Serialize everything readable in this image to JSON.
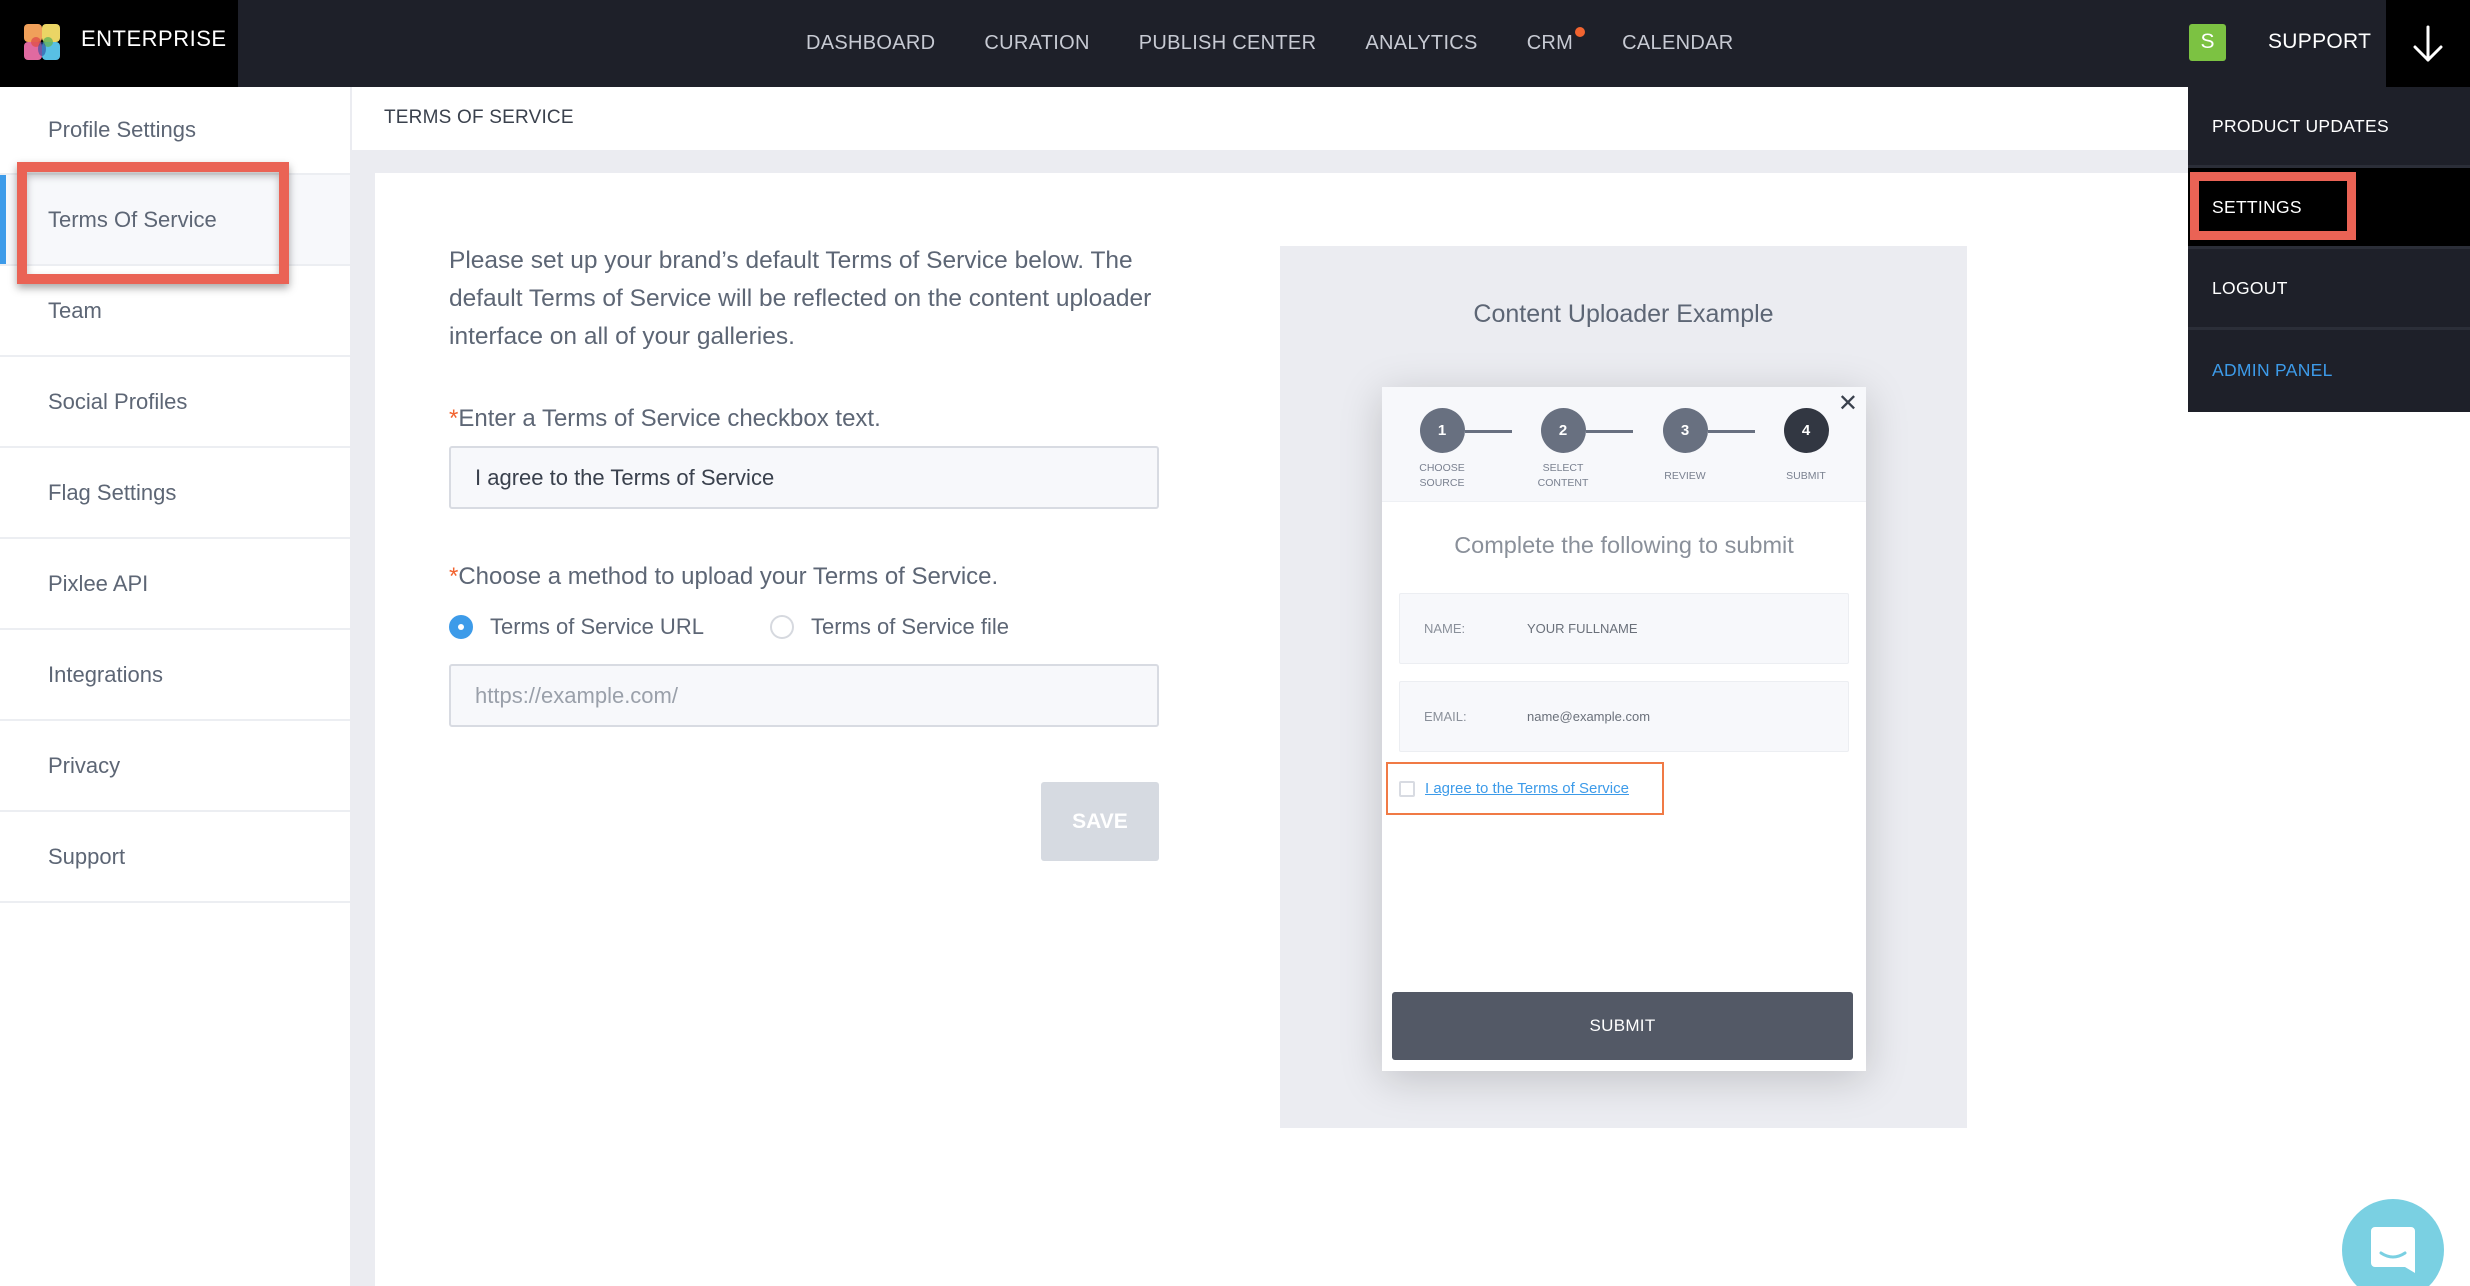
{
  "header": {
    "brand": "ENTERPRISE",
    "nav": [
      {
        "label": "DASHBOARD",
        "badge": false
      },
      {
        "label": "CURATION",
        "badge": false
      },
      {
        "label": "PUBLISH CENTER",
        "badge": false
      },
      {
        "label": "ANALYTICS",
        "badge": false
      },
      {
        "label": "CRM",
        "badge": true
      },
      {
        "label": "CALENDAR",
        "badge": false
      }
    ],
    "avatar_initial": "S",
    "support_label": "SUPPORT",
    "menu_icon": "arrow-down-icon"
  },
  "dropdown": {
    "items": [
      {
        "label": "PRODUCT UPDATES"
      },
      {
        "label": "SETTINGS",
        "selected": true
      },
      {
        "label": "LOGOUT"
      },
      {
        "label": "ADMIN PANEL"
      }
    ]
  },
  "sidebar": {
    "items": [
      {
        "label": "Profile Settings"
      },
      {
        "label": "Terms Of Service",
        "active": true
      },
      {
        "label": "Team"
      },
      {
        "label": "Social Profiles"
      },
      {
        "label": "Flag Settings"
      },
      {
        "label": "Pixlee API"
      },
      {
        "label": "Integrations"
      },
      {
        "label": "Privacy"
      },
      {
        "label": "Support"
      }
    ]
  },
  "page": {
    "title": "TERMS OF SERVICE",
    "intro": "Please set up your brand’s default Terms of Service below. The default Terms of Service will be reflected on the content uploader interface on all of your galleries.",
    "checkbox_text_label": "Enter a Terms of Service checkbox text.",
    "checkbox_text_value": "I agree to the Terms of Service",
    "method_label": "Choose a method to upload your Terms of Service.",
    "required_mark": "*",
    "methods": [
      {
        "label": "Terms of Service URL",
        "checked": true
      },
      {
        "label": "Terms of Service file",
        "checked": false
      }
    ],
    "url_placeholder": "https://example.com/",
    "url_value": "",
    "save_label": "SAVE"
  },
  "preview": {
    "title": "Content Uploader Example",
    "close_icon": "close-icon",
    "steps": [
      {
        "number": "1",
        "label": "CHOOSE SOURCE"
      },
      {
        "number": "2",
        "label": "SELECT CONTENT"
      },
      {
        "number": "3",
        "label": "REVIEW"
      },
      {
        "number": "4",
        "label": "SUBMIT",
        "current": true
      }
    ],
    "heading": "Complete the following to submit",
    "name_label": "NAME:",
    "name_value": "YOUR FULLNAME",
    "email_label": "EMAIL:",
    "email_value": "name@example.com",
    "tos_link": "I agree to the Terms of Service",
    "submit_label": "SUBMIT"
  },
  "colors": {
    "accent_blue": "#3d9be9",
    "highlight_red": "#ea6355",
    "required_orange": "#f26430",
    "topbar": "#1e2029",
    "avatar_green": "#7cc242",
    "chat": "#7ad0e2"
  }
}
